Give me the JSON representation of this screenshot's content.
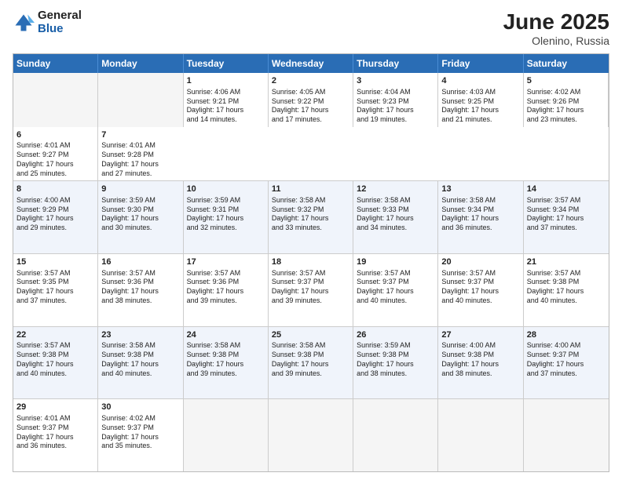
{
  "logo": {
    "general": "General",
    "blue": "Blue"
  },
  "title": {
    "month": "June 2025",
    "location": "Olenino, Russia"
  },
  "header_days": [
    "Sunday",
    "Monday",
    "Tuesday",
    "Wednesday",
    "Thursday",
    "Friday",
    "Saturday"
  ],
  "rows": [
    [
      {
        "day": "",
        "lines": []
      },
      {
        "day": "1",
        "lines": [
          "Sunrise: 4:06 AM",
          "Sunset: 9:21 PM",
          "Daylight: 17 hours",
          "and 14 minutes."
        ]
      },
      {
        "day": "2",
        "lines": [
          "Sunrise: 4:05 AM",
          "Sunset: 9:22 PM",
          "Daylight: 17 hours",
          "and 17 minutes."
        ]
      },
      {
        "day": "3",
        "lines": [
          "Sunrise: 4:04 AM",
          "Sunset: 9:23 PM",
          "Daylight: 17 hours",
          "and 19 minutes."
        ]
      },
      {
        "day": "4",
        "lines": [
          "Sunrise: 4:03 AM",
          "Sunset: 9:25 PM",
          "Daylight: 17 hours",
          "and 21 minutes."
        ]
      },
      {
        "day": "5",
        "lines": [
          "Sunrise: 4:02 AM",
          "Sunset: 9:26 PM",
          "Daylight: 17 hours",
          "and 23 minutes."
        ]
      },
      {
        "day": "6",
        "lines": [
          "Sunrise: 4:01 AM",
          "Sunset: 9:27 PM",
          "Daylight: 17 hours",
          "and 25 minutes."
        ]
      },
      {
        "day": "7",
        "lines": [
          "Sunrise: 4:01 AM",
          "Sunset: 9:28 PM",
          "Daylight: 17 hours",
          "and 27 minutes."
        ]
      }
    ],
    [
      {
        "day": "8",
        "lines": [
          "Sunrise: 4:00 AM",
          "Sunset: 9:29 PM",
          "Daylight: 17 hours",
          "and 29 minutes."
        ]
      },
      {
        "day": "9",
        "lines": [
          "Sunrise: 3:59 AM",
          "Sunset: 9:30 PM",
          "Daylight: 17 hours",
          "and 30 minutes."
        ]
      },
      {
        "day": "10",
        "lines": [
          "Sunrise: 3:59 AM",
          "Sunset: 9:31 PM",
          "Daylight: 17 hours",
          "and 32 minutes."
        ]
      },
      {
        "day": "11",
        "lines": [
          "Sunrise: 3:58 AM",
          "Sunset: 9:32 PM",
          "Daylight: 17 hours",
          "and 33 minutes."
        ]
      },
      {
        "day": "12",
        "lines": [
          "Sunrise: 3:58 AM",
          "Sunset: 9:33 PM",
          "Daylight: 17 hours",
          "and 34 minutes."
        ]
      },
      {
        "day": "13",
        "lines": [
          "Sunrise: 3:58 AM",
          "Sunset: 9:34 PM",
          "Daylight: 17 hours",
          "and 36 minutes."
        ]
      },
      {
        "day": "14",
        "lines": [
          "Sunrise: 3:57 AM",
          "Sunset: 9:34 PM",
          "Daylight: 17 hours",
          "and 37 minutes."
        ]
      }
    ],
    [
      {
        "day": "15",
        "lines": [
          "Sunrise: 3:57 AM",
          "Sunset: 9:35 PM",
          "Daylight: 17 hours",
          "and 37 minutes."
        ]
      },
      {
        "day": "16",
        "lines": [
          "Sunrise: 3:57 AM",
          "Sunset: 9:36 PM",
          "Daylight: 17 hours",
          "and 38 minutes."
        ]
      },
      {
        "day": "17",
        "lines": [
          "Sunrise: 3:57 AM",
          "Sunset: 9:36 PM",
          "Daylight: 17 hours",
          "and 39 minutes."
        ]
      },
      {
        "day": "18",
        "lines": [
          "Sunrise: 3:57 AM",
          "Sunset: 9:37 PM",
          "Daylight: 17 hours",
          "and 39 minutes."
        ]
      },
      {
        "day": "19",
        "lines": [
          "Sunrise: 3:57 AM",
          "Sunset: 9:37 PM",
          "Daylight: 17 hours",
          "and 40 minutes."
        ]
      },
      {
        "day": "20",
        "lines": [
          "Sunrise: 3:57 AM",
          "Sunset: 9:37 PM",
          "Daylight: 17 hours",
          "and 40 minutes."
        ]
      },
      {
        "day": "21",
        "lines": [
          "Sunrise: 3:57 AM",
          "Sunset: 9:38 PM",
          "Daylight: 17 hours",
          "and 40 minutes."
        ]
      }
    ],
    [
      {
        "day": "22",
        "lines": [
          "Sunrise: 3:57 AM",
          "Sunset: 9:38 PM",
          "Daylight: 17 hours",
          "and 40 minutes."
        ]
      },
      {
        "day": "23",
        "lines": [
          "Sunrise: 3:58 AM",
          "Sunset: 9:38 PM",
          "Daylight: 17 hours",
          "and 40 minutes."
        ]
      },
      {
        "day": "24",
        "lines": [
          "Sunrise: 3:58 AM",
          "Sunset: 9:38 PM",
          "Daylight: 17 hours",
          "and 39 minutes."
        ]
      },
      {
        "day": "25",
        "lines": [
          "Sunrise: 3:58 AM",
          "Sunset: 9:38 PM",
          "Daylight: 17 hours",
          "and 39 minutes."
        ]
      },
      {
        "day": "26",
        "lines": [
          "Sunrise: 3:59 AM",
          "Sunset: 9:38 PM",
          "Daylight: 17 hours",
          "and 38 minutes."
        ]
      },
      {
        "day": "27",
        "lines": [
          "Sunrise: 4:00 AM",
          "Sunset: 9:38 PM",
          "Daylight: 17 hours",
          "and 38 minutes."
        ]
      },
      {
        "day": "28",
        "lines": [
          "Sunrise: 4:00 AM",
          "Sunset: 9:37 PM",
          "Daylight: 17 hours",
          "and 37 minutes."
        ]
      }
    ],
    [
      {
        "day": "29",
        "lines": [
          "Sunrise: 4:01 AM",
          "Sunset: 9:37 PM",
          "Daylight: 17 hours",
          "and 36 minutes."
        ]
      },
      {
        "day": "30",
        "lines": [
          "Sunrise: 4:02 AM",
          "Sunset: 9:37 PM",
          "Daylight: 17 hours",
          "and 35 minutes."
        ]
      },
      {
        "day": "",
        "lines": []
      },
      {
        "day": "",
        "lines": []
      },
      {
        "day": "",
        "lines": []
      },
      {
        "day": "",
        "lines": []
      },
      {
        "day": "",
        "lines": []
      }
    ]
  ]
}
